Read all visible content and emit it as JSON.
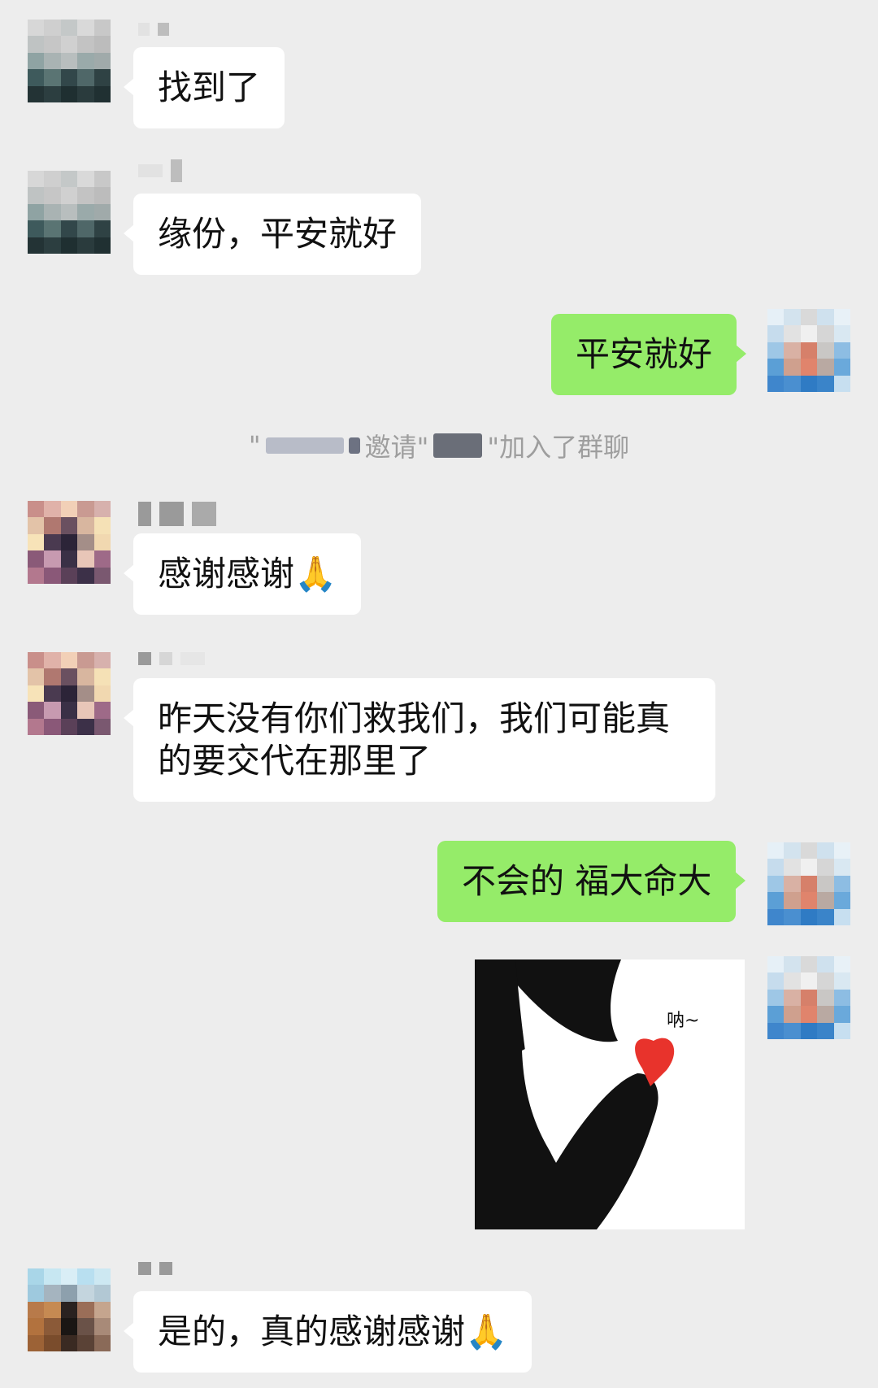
{
  "messages": [
    {
      "side": "left",
      "text": "找到了"
    },
    {
      "side": "left",
      "text": "缘份，平安就好"
    },
    {
      "side": "right",
      "text": "平安就好"
    },
    {
      "side": "left",
      "text": "感谢感谢🙏"
    },
    {
      "side": "left",
      "text_lines": [
        "昨天没有你们救我们，我们可能真",
        "的要交代在那里了"
      ]
    },
    {
      "side": "right",
      "text": "不会的 福大命大"
    },
    {
      "side": "right",
      "sticker_text": "呐~"
    },
    {
      "side": "left",
      "text": "是的，真的感谢感谢🙏"
    }
  ],
  "system_notice": {
    "quote_open": "\"",
    "invite": "邀请\"",
    "joined": "\"加入了群聊"
  },
  "colors": {
    "background": "#ededed",
    "incoming_bubble": "#ffffff",
    "outgoing_bubble": "#95ec69",
    "heart": "#e8332c"
  },
  "icons": [
    "praying-hands-emoji"
  ]
}
